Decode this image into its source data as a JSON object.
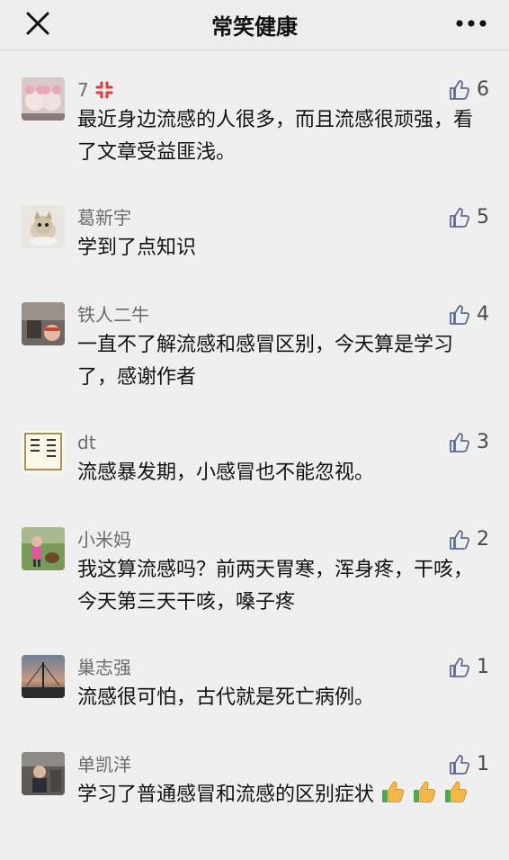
{
  "header": {
    "title": "常笑健康"
  },
  "comments": [
    {
      "nick": "7",
      "likes": "6",
      "text": "最近身边流感的人很多，而且流感很顽强，看了文章受益匪浅。"
    },
    {
      "nick": "葛新宇",
      "likes": "5",
      "text": "学到了点知识"
    },
    {
      "nick": "铁人二牛",
      "likes": "4",
      "text": "一直不了解流感和感冒区别，今天算是学习了，感谢作者"
    },
    {
      "nick": "dt",
      "likes": "3",
      "text": "流感暴发期，小感冒也不能忽视。"
    },
    {
      "nick": "小米妈",
      "likes": "2",
      "text": "我这算流感吗？前两天胃寒，浑身疼，干咳，今天第三天干咳，嗓子疼"
    },
    {
      "nick": "巢志强",
      "likes": "1",
      "text": "流感很可怕，古代就是死亡病例。"
    },
    {
      "nick": "单凯洋",
      "likes": "1",
      "text": "学习了普通感冒和流感的区别症状"
    }
  ],
  "icons": {
    "close": "close-icon",
    "more": "more-icon",
    "like": "thumbs-up-icon",
    "anger": "anger-emoji-icon",
    "thumb_emoji": "thumbs-up-emoji-icon"
  },
  "colors": {
    "background": "#efefef",
    "header": "#ededed",
    "like_icon": "#5b6b8e"
  }
}
